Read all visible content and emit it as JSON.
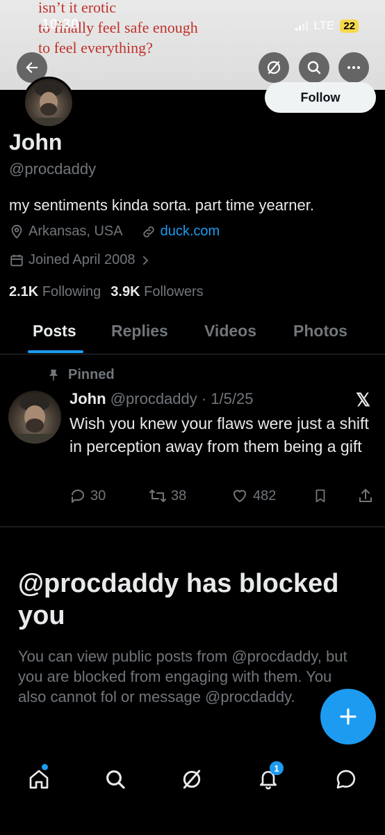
{
  "banner": {
    "lines": [
      "isn’t it erotic",
      "to finally feel safe enough",
      "to feel everything?"
    ]
  },
  "status_bar": {
    "time": "10:30",
    "network": "LTE",
    "battery": "22"
  },
  "profile": {
    "follow_label": "Follow",
    "display_name": "John",
    "handle": "@procdaddy",
    "bio": "my sentiments kinda sorta. part time yearner.",
    "location": "Arkansas, USA",
    "website": "duck.com",
    "joined": "Joined April 2008",
    "following_count": "2.1K",
    "following_label": "Following",
    "followers_count": "3.9K",
    "followers_label": "Followers"
  },
  "tabs": [
    {
      "label": "Posts",
      "active": true
    },
    {
      "label": "Replies",
      "active": false
    },
    {
      "label": "Videos",
      "active": false
    },
    {
      "label": "Photos",
      "active": false
    }
  ],
  "pinned_post": {
    "pinned_label": "Pinned",
    "author": "John",
    "handle_date": "@procdaddy · 1/5/25",
    "text": "Wish you knew your flaws were just a shift in perception away from them being a gift",
    "replies": "30",
    "reposts": "38",
    "likes": "482"
  },
  "blocked": {
    "title": "@procdaddy has blocked you",
    "body": "You can view public posts from @procdaddy, but you are blocked from engaging with them. You also cannot fol   or message @procdaddy."
  },
  "bottom_nav": {
    "notification_count": "1"
  },
  "colors": {
    "accent": "#1d9bf0",
    "muted": "#71767b",
    "text": "#e7e9ea",
    "banner_text": "#c0312b"
  }
}
